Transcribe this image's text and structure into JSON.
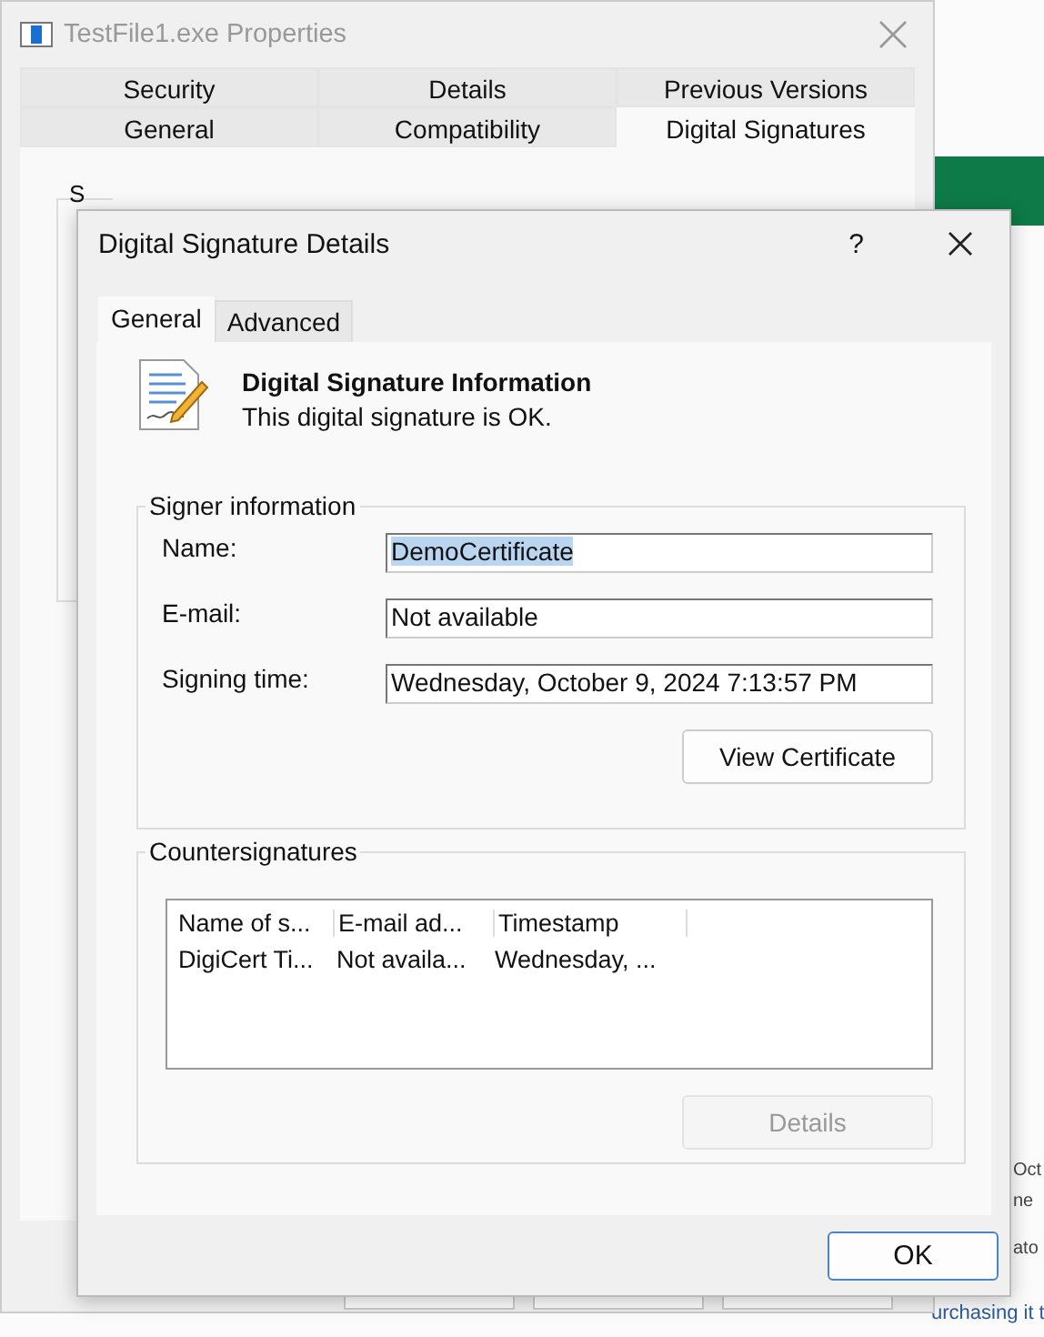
{
  "background_window": {
    "fragments": [
      "Oct",
      "ne",
      "ato",
      "urchasing it t"
    ]
  },
  "properties_window": {
    "title": "TestFile1.exe Properties",
    "tab_rows": [
      [
        {
          "label": "Security",
          "selected": false
        },
        {
          "label": "Details",
          "selected": false
        },
        {
          "label": "Previous Versions",
          "selected": false
        }
      ],
      [
        {
          "label": "General",
          "selected": false
        },
        {
          "label": "Compatibility",
          "selected": false
        },
        {
          "label": "Digital Signatures",
          "selected": true
        }
      ]
    ],
    "group_label": "S"
  },
  "dialog": {
    "title": "Digital Signature Details",
    "help": "?",
    "tabs": [
      {
        "label": "General",
        "selected": true
      },
      {
        "label": "Advanced",
        "selected": false
      }
    ],
    "heading": "Digital Signature Information",
    "status": "This digital signature is OK.",
    "signer": {
      "title": "Signer information",
      "fields": [
        {
          "label": "Name:",
          "value": "DemoCertificate",
          "selected": true
        },
        {
          "label": "E-mail:",
          "value": "Not available",
          "selected": false
        },
        {
          "label": "Signing time:",
          "value": "Wednesday, October 9, 2024 7:13:57 PM",
          "selected": false
        }
      ],
      "button": "View Certificate"
    },
    "countersignatures": {
      "title": "Countersignatures",
      "columns": [
        "Name of s...",
        "E-mail ad...",
        "Timestamp"
      ],
      "rows": [
        [
          "DigiCert Ti...",
          "Not availa...",
          "Wednesday, ..."
        ]
      ],
      "button": {
        "label": "Details",
        "disabled": true
      }
    },
    "ok": "OK"
  }
}
